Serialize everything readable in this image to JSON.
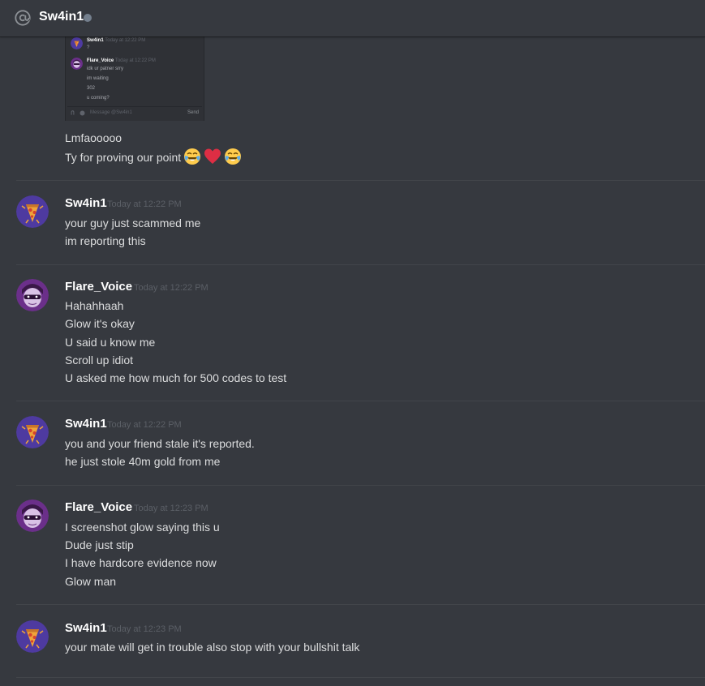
{
  "header": {
    "channel_name": "Sw4in1",
    "icon": "at-icon",
    "status": "offline"
  },
  "attachment": {
    "lines": [
      {
        "author": "Sw4in1",
        "timestamp": "Today at 12:22 PM",
        "text": "?"
      },
      {
        "author": "Flare_Voice",
        "timestamp": "Today at 12:22 PM",
        "text": "idk ur patner srry"
      },
      {
        "text": "im waiting"
      },
      {
        "text": "302"
      },
      {
        "text": "u coming?"
      }
    ],
    "input_placeholder": "Message @Sw4in1",
    "send_label": "Send"
  },
  "top_message": {
    "lines": [
      "Lmfaooooo",
      "Ty for proving our point"
    ],
    "emojis": [
      "joy-emoji",
      "red-heart-emoji",
      "joy-emoji"
    ]
  },
  "messages": [
    {
      "author": "Sw4in1",
      "timestamp": "Today at 12:22 PM",
      "avatar": "pizza-avatar",
      "lines": [
        "your guy just scammed me",
        "im reporting this"
      ]
    },
    {
      "author": "Flare_Voice",
      "timestamp": "Today at 12:22 PM",
      "avatar": "masked-character-avatar",
      "lines": [
        "Hahahhaah",
        "Glow it's okay",
        "U said u know me",
        "Scroll up idiot",
        "U asked me how much for 500 codes to test"
      ]
    },
    {
      "author": "Sw4in1",
      "timestamp": "Today at 12:22 PM",
      "avatar": "pizza-avatar",
      "lines": [
        "you and your friend stale it's reported.",
        "he just stole 40m gold from me"
      ]
    },
    {
      "author": "Flare_Voice",
      "timestamp": "Today at 12:23 PM",
      "avatar": "masked-character-avatar",
      "lines": [
        "I screenshot glow saying this u",
        "Dude just stip",
        "I have hardcore evidence now",
        "Glow man"
      ]
    },
    {
      "author": "Sw4in1",
      "timestamp": "Today at 12:23 PM",
      "avatar": "pizza-avatar",
      "lines": [
        "your mate will get in trouble also stop with your bullshit talk"
      ]
    }
  ],
  "colors": {
    "background": "#36393f",
    "author": "#ffffff",
    "timestamp": "#5b5f66",
    "text": "#dcddde",
    "divider": "#42454a",
    "pizza_avatar_bg": "#4e3aa0",
    "masked_avatar_bg": "#6b2f8a"
  }
}
